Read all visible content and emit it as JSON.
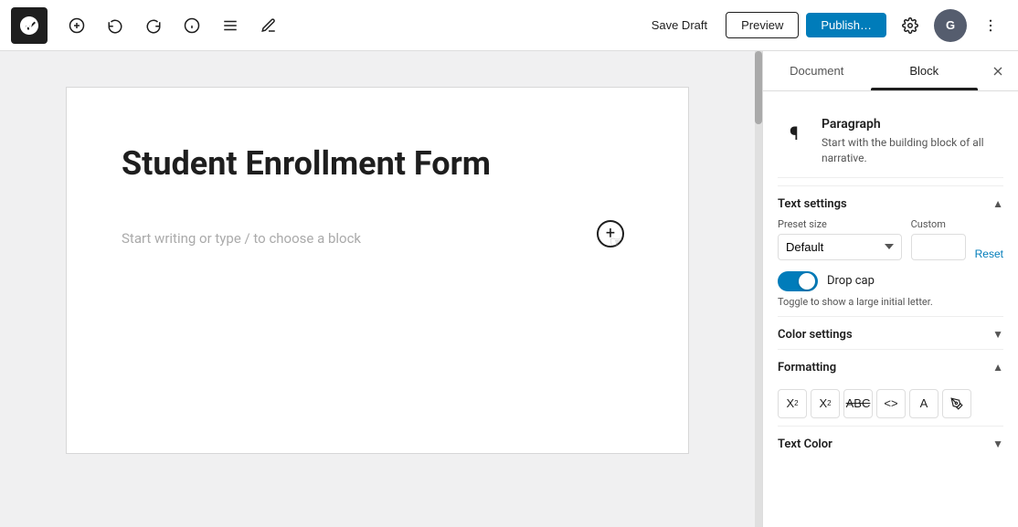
{
  "toolbar": {
    "undo_label": "Undo",
    "redo_label": "Redo",
    "info_label": "Document info",
    "list_view_label": "List view",
    "tools_label": "Tools",
    "save_draft_label": "Save Draft",
    "preview_label": "Preview",
    "publish_label": "Publish…",
    "settings_label": "Settings",
    "avatar_label": "G",
    "more_label": "More"
  },
  "editor": {
    "post_title": "Student Enrollment Form",
    "placeholder": "Start writing or type / to choose a block"
  },
  "sidebar": {
    "tab_document": "Document",
    "tab_block": "Block",
    "close_label": "×",
    "block": {
      "icon": "¶",
      "title": "Paragraph",
      "description": "Start with the building block of all narrative."
    },
    "text_settings": {
      "title": "Text settings",
      "preset_size_label": "Preset size",
      "preset_size_default": "Default",
      "custom_label": "Custom",
      "reset_label": "Reset"
    },
    "drop_cap": {
      "label": "Drop cap",
      "hint": "Toggle to show a large initial letter."
    },
    "color_settings": {
      "title": "Color settings"
    },
    "formatting": {
      "title": "Formatting",
      "buttons": [
        {
          "name": "superscript",
          "symbol": "X²"
        },
        {
          "name": "subscript",
          "symbol": "X₂"
        },
        {
          "name": "strikethrough",
          "symbol": "abc̶"
        },
        {
          "name": "inline-code",
          "symbol": "<>"
        },
        {
          "name": "keyboard",
          "symbol": "A"
        },
        {
          "name": "color",
          "symbol": "🖊"
        }
      ]
    },
    "text_color": {
      "title": "Text Color"
    }
  }
}
